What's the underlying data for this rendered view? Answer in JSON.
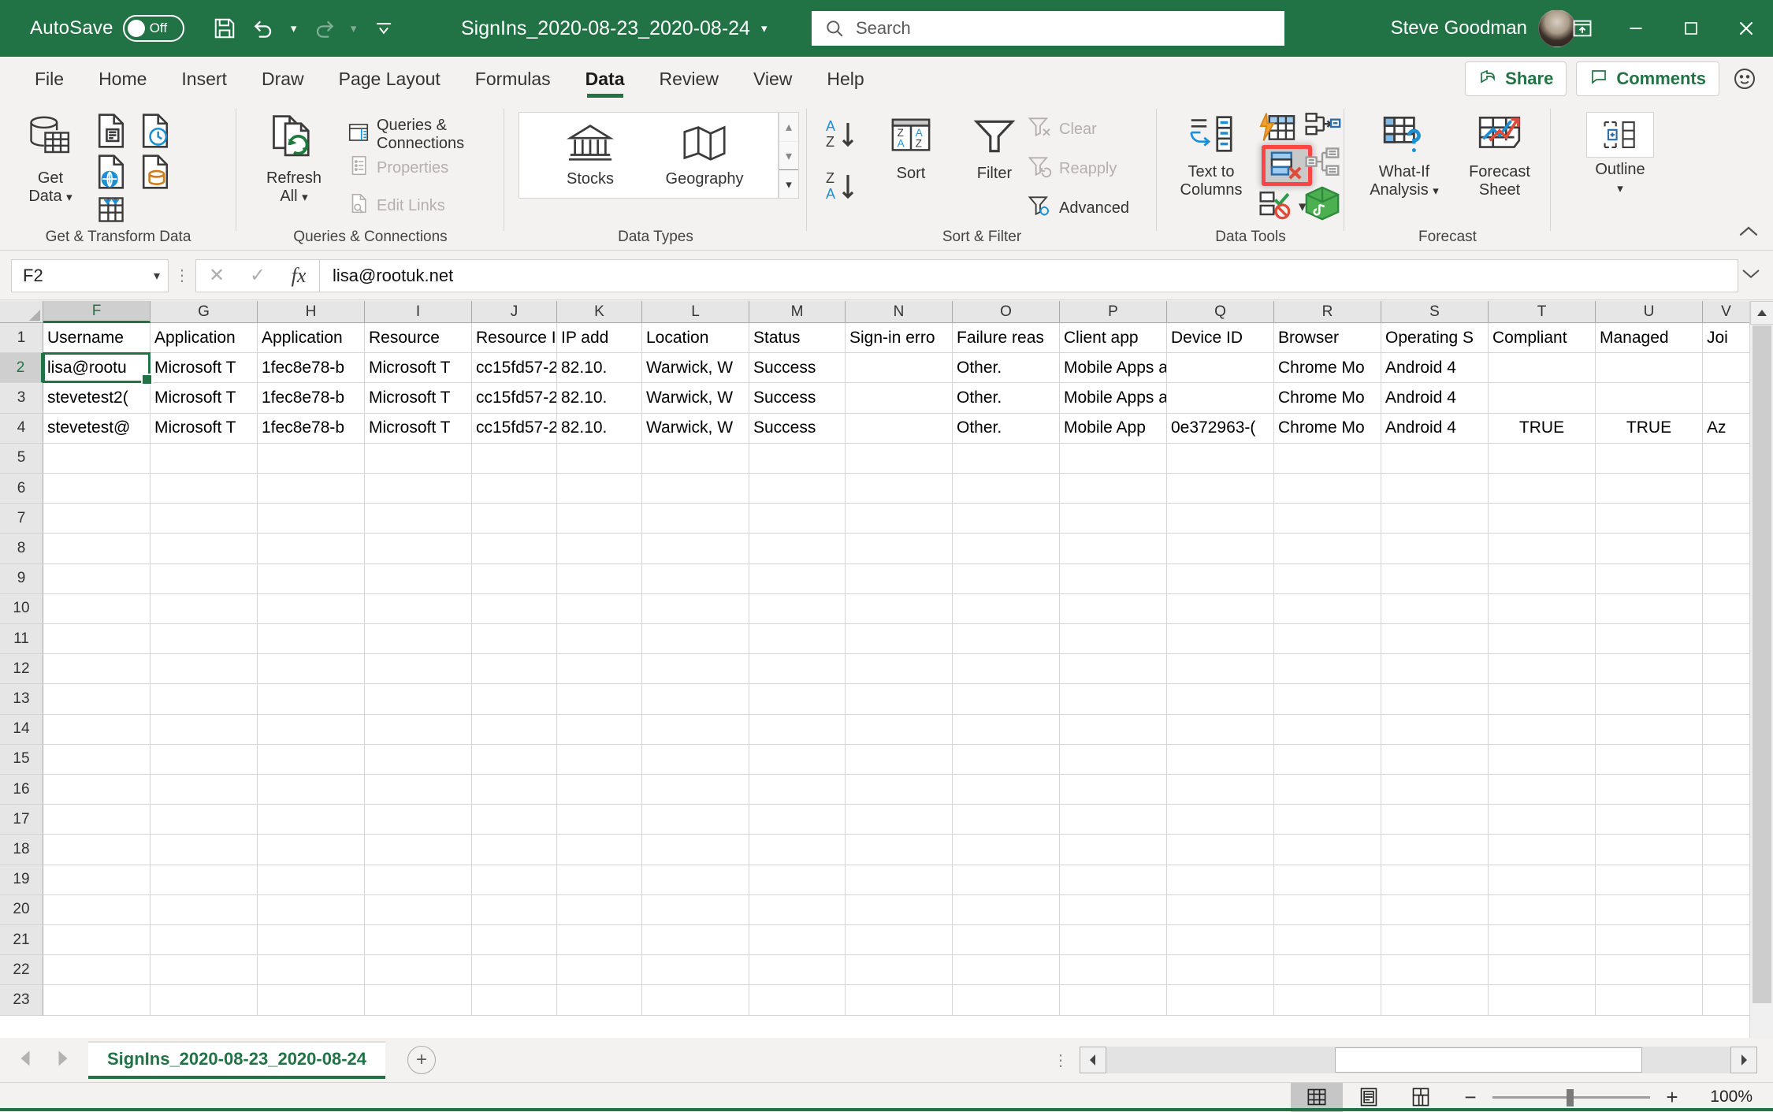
{
  "titlebar": {
    "autosave_label": "AutoSave",
    "autosave_state": "Off",
    "document_title": "SignIns_2020-08-23_2020-08-24",
    "account_name": "Steve Goodman",
    "quick_access": [
      {
        "name": "save-icon",
        "label": "Save"
      },
      {
        "name": "undo-icon",
        "label": "Undo"
      },
      {
        "name": "redo-icon",
        "label": "Redo"
      },
      {
        "name": "customize-quick-access-icon",
        "label": "Customize Quick Access Toolbar"
      }
    ],
    "window_buttons": [
      "restore-down",
      "minimize",
      "maximize",
      "close"
    ]
  },
  "search": {
    "placeholder": "Search",
    "icon": "search-icon"
  },
  "ribbon": {
    "tabs": [
      {
        "label": "File",
        "active": false
      },
      {
        "label": "Home",
        "active": false
      },
      {
        "label": "Insert",
        "active": false
      },
      {
        "label": "Draw",
        "active": false
      },
      {
        "label": "Page Layout",
        "active": false
      },
      {
        "label": "Formulas",
        "active": false
      },
      {
        "label": "Data",
        "active": true
      },
      {
        "label": "Review",
        "active": false
      },
      {
        "label": "View",
        "active": false
      },
      {
        "label": "Help",
        "active": false
      }
    ],
    "share_label": "Share",
    "comments_label": "Comments",
    "groups": [
      {
        "name": "Get & Transform Data",
        "big": [
          {
            "label": "Get\nData",
            "icon": "get-data-icon",
            "has_caret": true
          }
        ],
        "small": []
      },
      {
        "name": "Queries & Connections",
        "big": [
          {
            "label": "Refresh\nAll",
            "icon": "refresh-all-icon",
            "has_caret": true
          }
        ],
        "small": [
          {
            "label": "Queries & Connections",
            "icon": "queries-connections-icon",
            "disabled": false
          },
          {
            "label": "Properties",
            "icon": "properties-icon",
            "disabled": true
          },
          {
            "label": "Edit Links",
            "icon": "edit-links-icon",
            "disabled": true
          }
        ]
      },
      {
        "name": "Data Types",
        "gallery": [
          {
            "label": "Stocks",
            "icon": "stocks-icon"
          },
          {
            "label": "Geography",
            "icon": "geography-icon"
          }
        ]
      },
      {
        "name": "Sort & Filter",
        "big": [
          {
            "label": "Sort",
            "icon": "sort-icon"
          },
          {
            "label": "Filter",
            "icon": "filter-icon"
          }
        ],
        "small": [
          {
            "label": "Clear",
            "icon": "clear-filter-icon",
            "disabled": true
          },
          {
            "label": "Reapply",
            "icon": "reapply-filter-icon",
            "disabled": true
          },
          {
            "label": "Advanced",
            "icon": "advanced-filter-icon",
            "disabled": false
          }
        ],
        "sort_az": "A-Z",
        "sort_za": "Z-A"
      },
      {
        "name": "Data Tools",
        "big": [
          {
            "label": "Text to\nColumns",
            "icon": "text-to-columns-icon"
          }
        ],
        "icons": [
          {
            "name": "flash-fill-icon",
            "label": "Flash Fill"
          },
          {
            "name": "remove-duplicates-icon",
            "label": "Remove Duplicates",
            "highlighted": true
          },
          {
            "name": "data-validation-icon",
            "label": "Data Validation",
            "has_caret": true
          },
          {
            "name": "consolidate-icon",
            "label": "Consolidate"
          },
          {
            "name": "relationships-icon",
            "label": "Relationships"
          },
          {
            "name": "manage-data-model-icon",
            "label": "Manage Data Model"
          }
        ]
      },
      {
        "name": "Forecast",
        "big": [
          {
            "label": "What-If\nAnalysis",
            "icon": "what-if-analysis-icon",
            "has_caret": true
          },
          {
            "label": "Forecast\nSheet",
            "icon": "forecast-sheet-icon"
          }
        ]
      },
      {
        "name": "",
        "big": [
          {
            "label": "Outline",
            "icon": "outline-icon",
            "has_caret": true
          }
        ]
      }
    ]
  },
  "formula_bar": {
    "name_box_value": "F2",
    "cancel_icon": "cancel-icon",
    "enter_icon": "enter-icon",
    "fx_icon": "insert-function-icon",
    "formula_value": "lisa@rootuk.net"
  },
  "grid": {
    "columns": [
      "F",
      "G",
      "H",
      "I",
      "J",
      "K",
      "L",
      "M",
      "N",
      "O",
      "P",
      "Q",
      "R",
      "S",
      "T",
      "U",
      "V"
    ],
    "selected_column": "F",
    "selected_row": 2,
    "rows": [
      1,
      2,
      3,
      4,
      5,
      6,
      7,
      8,
      9,
      10,
      11,
      12,
      13,
      14,
      15,
      16,
      17,
      18,
      19,
      20,
      21,
      22,
      23
    ],
    "data": {
      "1": [
        "Username",
        "Application",
        "Application",
        "Resource",
        "Resource ID",
        "IP add",
        "Location",
        "Status",
        "Sign-in erro",
        "Failure reas",
        "Client app",
        "Device ID",
        "Browser",
        "Operating S",
        "Compliant",
        "Managed",
        "Joi"
      ],
      "2": [
        "lisa@rootu",
        "Microsoft T",
        "1fec8e78-b",
        "Microsoft T",
        "cc15fd57-2",
        "82.10.",
        "Warwick, W",
        "Success",
        "",
        "Other.",
        "Mobile Apps and Deskt",
        "",
        "Chrome Mo",
        "Android 4",
        "",
        "",
        ""
      ],
      "3": [
        "stevetest2(",
        "Microsoft T",
        "1fec8e78-b",
        "Microsoft T",
        "cc15fd57-2",
        "82.10.",
        "Warwick, W",
        "Success",
        "",
        "Other.",
        "Mobile Apps and Deskt",
        "",
        "Chrome Mo",
        "Android 4",
        "",
        "",
        ""
      ],
      "4": [
        "stevetest@",
        "Microsoft T",
        "1fec8e78-b",
        "Microsoft T",
        "cc15fd57-2",
        "82.10.",
        "Warwick, W",
        "Success",
        "",
        "Other.",
        "Mobile App",
        "0e372963-(",
        "Chrome Mo",
        "Android 4",
        "TRUE",
        "TRUE",
        "Az"
      ]
    }
  },
  "sheet_bar": {
    "tab_name": "SignIns_2020-08-23_2020-08-24",
    "add_sheet_label": "+",
    "prev_icon": "prev-sheet-icon",
    "next_icon": "next-sheet-icon"
  },
  "status_bar": {
    "views": [
      {
        "name": "normal-view-icon",
        "label": "Normal",
        "active": true
      },
      {
        "name": "page-layout-view-icon",
        "label": "Page Layout",
        "active": false
      },
      {
        "name": "page-break-preview-icon",
        "label": "Page Break Preview",
        "active": false
      }
    ],
    "zoom_out": "−",
    "zoom_in": "+",
    "zoom_level": "100%"
  },
  "colors": {
    "excel_green": "#217346",
    "highlight_red": "#fc4646",
    "accent_blue": "#1a8fd6"
  }
}
